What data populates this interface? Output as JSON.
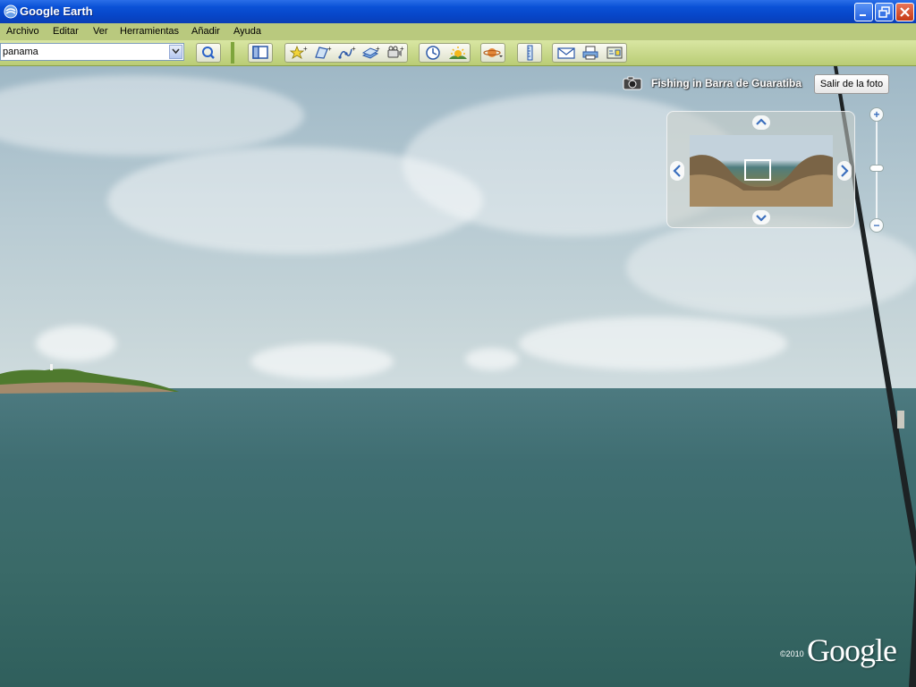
{
  "window": {
    "title": "Google Earth",
    "minimize_icon": "minimize-icon",
    "maximize_icon": "restore-icon",
    "close_icon": "close-icon"
  },
  "menu": {
    "items": [
      "Archivo",
      "Editar",
      "Ver",
      "Herramientas",
      "Añadir",
      "Ayuda"
    ]
  },
  "toolbar": {
    "search_value": "panama",
    "search_icon": "magnifier-icon",
    "buttons": [
      "sidebar-toggle-icon",
      "add-placemark-icon",
      "add-polygon-icon",
      "add-path-icon",
      "add-image-overlay-icon",
      "record-tour-icon",
      "historical-imagery-icon",
      "sunlight-icon",
      "switch-planet-icon",
      "ruler-icon",
      "email-icon",
      "print-icon",
      "view-in-maps-icon"
    ]
  },
  "photo": {
    "title": "Fishing in Barra de Guaratiba",
    "exit_label": "Salir de la foto",
    "camera_icon": "camera-icon"
  },
  "navigator": {
    "up_icon": "chevron-up-icon",
    "down_icon": "chevron-down-icon",
    "left_icon": "chevron-left-icon",
    "right_icon": "chevron-right-icon"
  },
  "zoom": {
    "plus": "+",
    "minus": "−"
  },
  "footer": {
    "copyright": "©2010",
    "logo": "Google"
  },
  "colors": {
    "titlebar": "#0a51d6",
    "menubar": "#b9c97e",
    "toolbar": "#c8d88a",
    "sea": "#3f6e72"
  }
}
